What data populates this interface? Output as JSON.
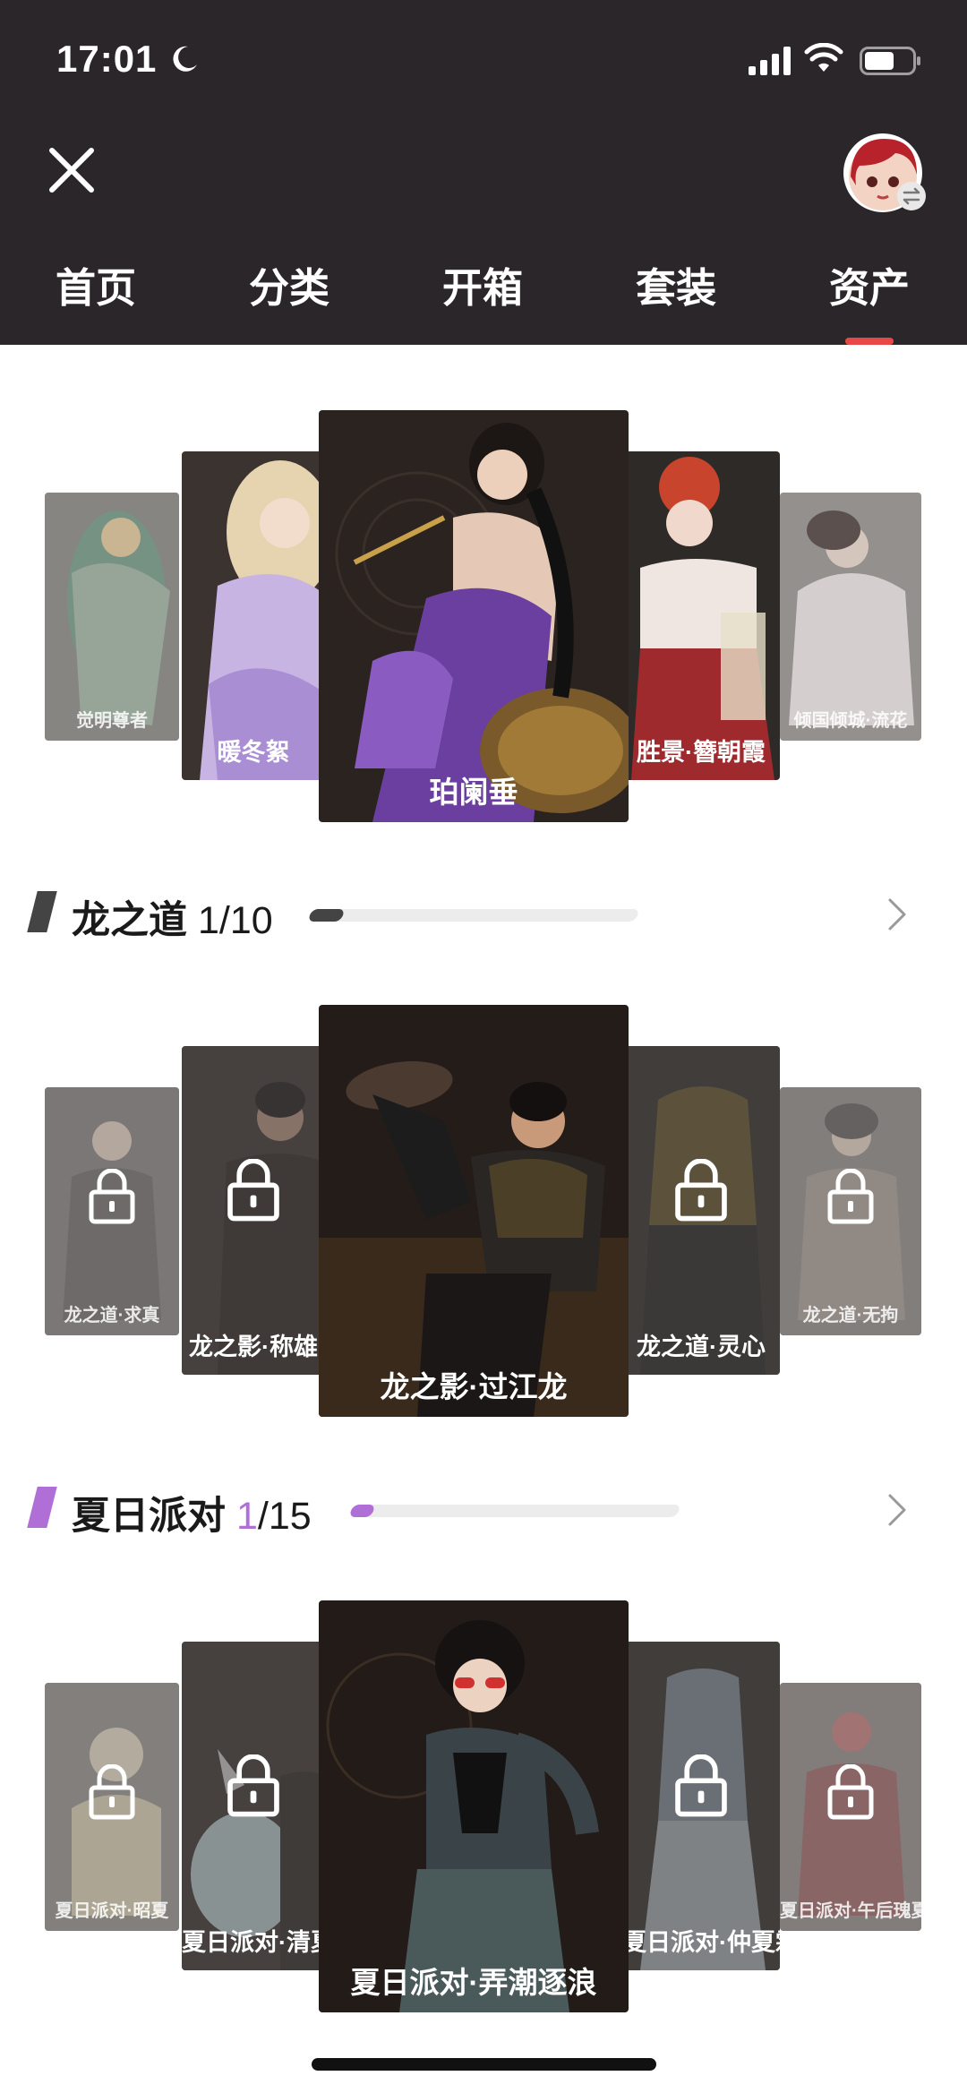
{
  "status_bar": {
    "time": "17:01"
  },
  "tabs": [
    {
      "label": "首页"
    },
    {
      "label": "分类"
    },
    {
      "label": "开箱"
    },
    {
      "label": "套装"
    },
    {
      "label": "资产"
    }
  ],
  "active_tab": "资产",
  "colors": {
    "header_bg": "#2a2629",
    "tab_indicator": "#e84747",
    "dragon_accent": "#444444",
    "summer_accent": "#b06fd6"
  },
  "carousel_featured": {
    "cards": [
      {
        "label": "觉明尊者"
      },
      {
        "label": "暖冬絮"
      },
      {
        "label": "珀阑垂"
      },
      {
        "label": "胜景·簪朝霞"
      },
      {
        "label": "倾国倾城·流花"
      }
    ]
  },
  "section_dragon": {
    "title": "龙之道",
    "owned": "1",
    "total": "/10",
    "progress_fraction": 0.1,
    "cards": [
      {
        "label": "龙之道·求真",
        "locked": true
      },
      {
        "label": "龙之影·称雄",
        "locked": true
      },
      {
        "label": "龙之影·过江龙",
        "locked": false
      },
      {
        "label": "龙之道·灵心",
        "locked": true
      },
      {
        "label": "龙之道·无拘",
        "locked": true
      }
    ]
  },
  "section_summer": {
    "title": "夏日派对",
    "owned": "1",
    "total": "/15",
    "progress_fraction": 0.067,
    "cards": [
      {
        "label": "夏日派对·昭夏",
        "locked": true
      },
      {
        "label": "夏日派对·清夏",
        "locked": true
      },
      {
        "label": "夏日派对·弄潮逐浪",
        "locked": false
      },
      {
        "label": "夏日派对·仲夏霜华",
        "locked": true
      },
      {
        "label": "夏日派对·午后瑰夏",
        "locked": true
      }
    ]
  }
}
